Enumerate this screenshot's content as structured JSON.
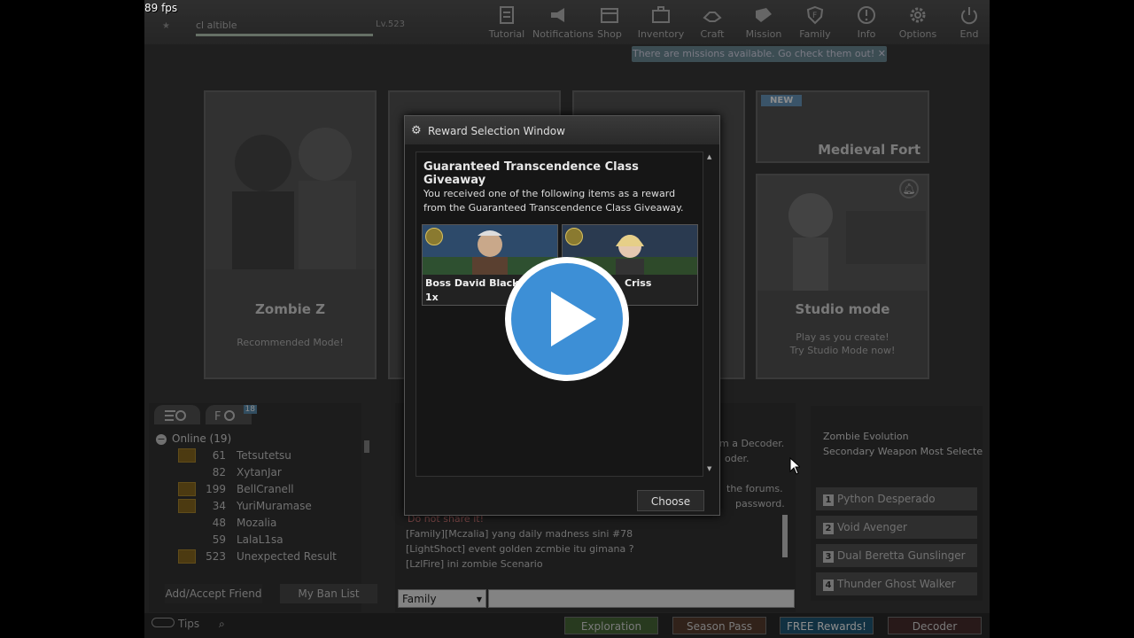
{
  "fps": "89 fps",
  "player": {
    "name": "cl altible",
    "level": "Lv.523"
  },
  "nav": [
    {
      "label": "Tutorial"
    },
    {
      "label": "Notifications"
    },
    {
      "label": "Shop"
    },
    {
      "label": "Inventory"
    },
    {
      "label": "Craft"
    },
    {
      "label": "Mission"
    },
    {
      "label": "Family"
    },
    {
      "label": "Info"
    },
    {
      "label": "Options"
    },
    {
      "label": "End"
    }
  ],
  "mission_tip": "There are missions available. Go check them out!",
  "modes": {
    "zombie_z": {
      "title": "Zombie Z",
      "sub": "Recommended Mode!"
    },
    "medieval_fort": {
      "title": "Medieval Fort",
      "badge": "NEW"
    },
    "studio": {
      "title": "Studio mode",
      "sub1": "Play as you create!",
      "sub2": "Try Studio Mode now!"
    }
  },
  "friends": {
    "group": "Online (19)",
    "badge": "18",
    "rows": [
      {
        "lvl": "61",
        "name": "Tetsutetsu",
        "gold": true
      },
      {
        "lvl": "82",
        "name": "XytanJar",
        "gold": false
      },
      {
        "lvl": "199",
        "name": "BellCranell",
        "gold": true
      },
      {
        "lvl": "34",
        "name": "YuriMuramase",
        "gold": true
      },
      {
        "lvl": "48",
        "name": "Mozalia",
        "gold": false
      },
      {
        "lvl": "59",
        "name": "LalaL1sa",
        "gold": false
      },
      {
        "lvl": "523",
        "name": "Unexpected Result",
        "gold": true
      }
    ],
    "add_btn": "Add/Accept Friend",
    "ban_btn": "My Ban List"
  },
  "chat": {
    "frag1": "m a Decoder.",
    "frag2": "oder.",
    "frag3": "the forums.",
    "frag4": "password.",
    "lines": [
      "Do not share it!",
      "[Family][Mczalia] yang daily madness sini #78",
      "[LightShoct] event golden zcmbie itu gimana ?",
      "[LzlFire] ini zombie Scenario"
    ],
    "channel": "Family"
  },
  "right_panel": {
    "mode": "Zombie Evolution",
    "subtitle": "Secondary Weapon Most Selecte",
    "weapons": [
      {
        "num": "1",
        "name": "Python Desperado"
      },
      {
        "num": "2",
        "name": "Void Avenger"
      },
      {
        "num": "3",
        "name": "Dual Beretta Gunslinger"
      },
      {
        "num": "4",
        "name": "Thunder Ghost Walker"
      }
    ]
  },
  "bottom": {
    "tips": "Tips",
    "exploration": "Exploration",
    "season_pass": "Season Pass",
    "free_rewards": "FREE Rewards!",
    "decoder": "Decoder"
  },
  "reward_window": {
    "title": "Reward Selection Window",
    "heading": "Guaranteed Transcendence Class Giveaway",
    "desc": "You received one of the following items as a reward from the Guaranteed Transcendence Class Giveaway.",
    "items": [
      {
        "name": "Boss David Black",
        "qty": "1x"
      },
      {
        "name": "Criss",
        "qty": ""
      }
    ],
    "choose": "Choose"
  },
  "colors": {
    "exploration": "#4a7a3a",
    "season_pass": "#6a4a3a",
    "free_rewards": "#2a6a8a",
    "decoder": "#5a3a3a",
    "play_blue": "#3d8fd6"
  }
}
